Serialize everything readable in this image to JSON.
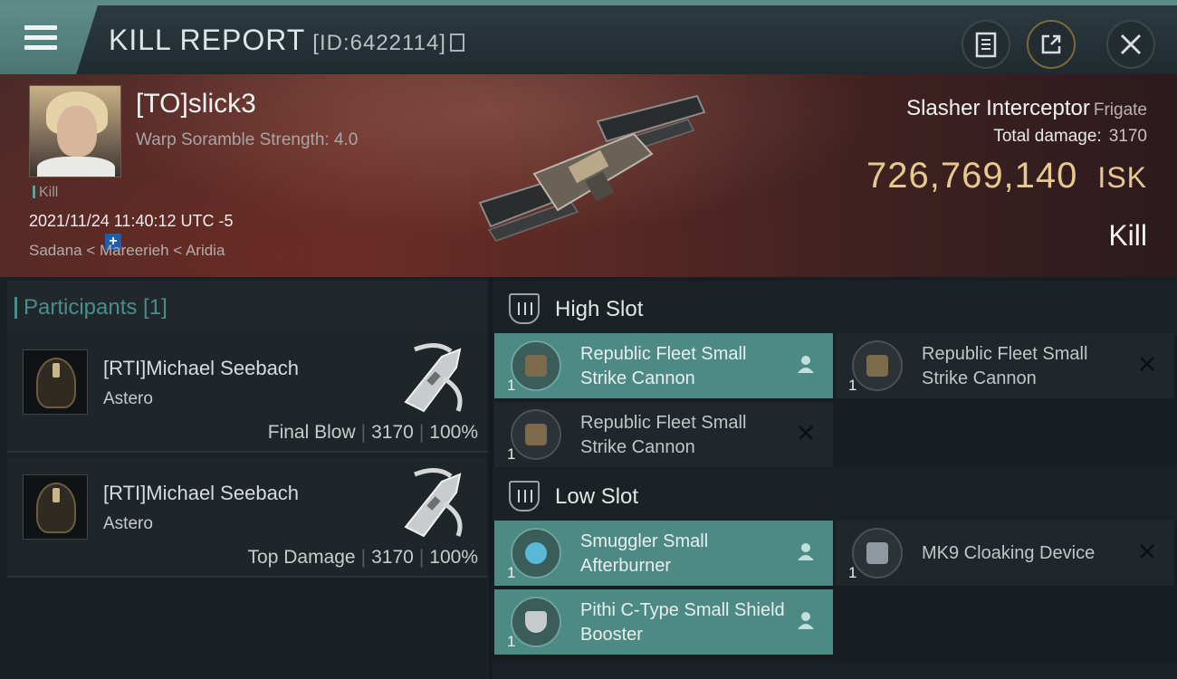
{
  "header": {
    "title": "KILL REPORT",
    "report_id": "[ID:6422114]"
  },
  "victim": {
    "name": "[TO]slick3",
    "warp_scramble": "Warp Soramble Strength: 4.0",
    "kill_tag": "Kill",
    "timestamp": "2021/11/24 11:40:12 UTC -5",
    "location": "Sadana < Mareerieh < Aridia",
    "ship_name": "Slasher Interceptor",
    "ship_class": "Frigate",
    "total_damage_label": "Total damage:",
    "total_damage": "3170",
    "isk_value": "726,769,140",
    "isk_unit": "ISK",
    "result": "Kill"
  },
  "participants": {
    "title": "Participants [1]",
    "rows": [
      {
        "name": "[RTI]Michael Seebach",
        "ship": "Astero",
        "role": "Final Blow",
        "damage": "3170",
        "percent": "100%"
      },
      {
        "name": "[RTI]Michael Seebach",
        "ship": "Astero",
        "role": "Top Damage",
        "damage": "3170",
        "percent": "100%"
      }
    ]
  },
  "fitting": {
    "high_slot": {
      "title": "High Slot",
      "modules": [
        {
          "name": "Republic Fleet Small Strike Cannon",
          "qty": "1",
          "status": "dropped"
        },
        {
          "name": "Republic Fleet Small Strike Cannon",
          "qty": "1",
          "status": "destroyed"
        },
        {
          "name": "Republic Fleet Small Strike Cannon",
          "qty": "1",
          "status": "destroyed"
        }
      ]
    },
    "low_slot": {
      "title": "Low Slot",
      "modules": [
        {
          "name": "Smuggler Small Afterburner",
          "qty": "1",
          "status": "dropped"
        },
        {
          "name": "MK9 Cloaking Device",
          "qty": "1",
          "status": "destroyed"
        },
        {
          "name": "Pithi C-Type Small Shield Booster",
          "qty": "1",
          "status": "dropped"
        }
      ]
    }
  },
  "icons": {
    "menu": "hamburger-menu-icon",
    "copy": "copy-icon",
    "report": "clipboard-icon",
    "share": "share-icon",
    "close": "close-icon",
    "dropped": "person-icon",
    "destroyed": "x-icon"
  },
  "colors": {
    "accent": "#4d8a83",
    "isk": "#e6c98e",
    "participants_title": "#4a8e8a"
  }
}
